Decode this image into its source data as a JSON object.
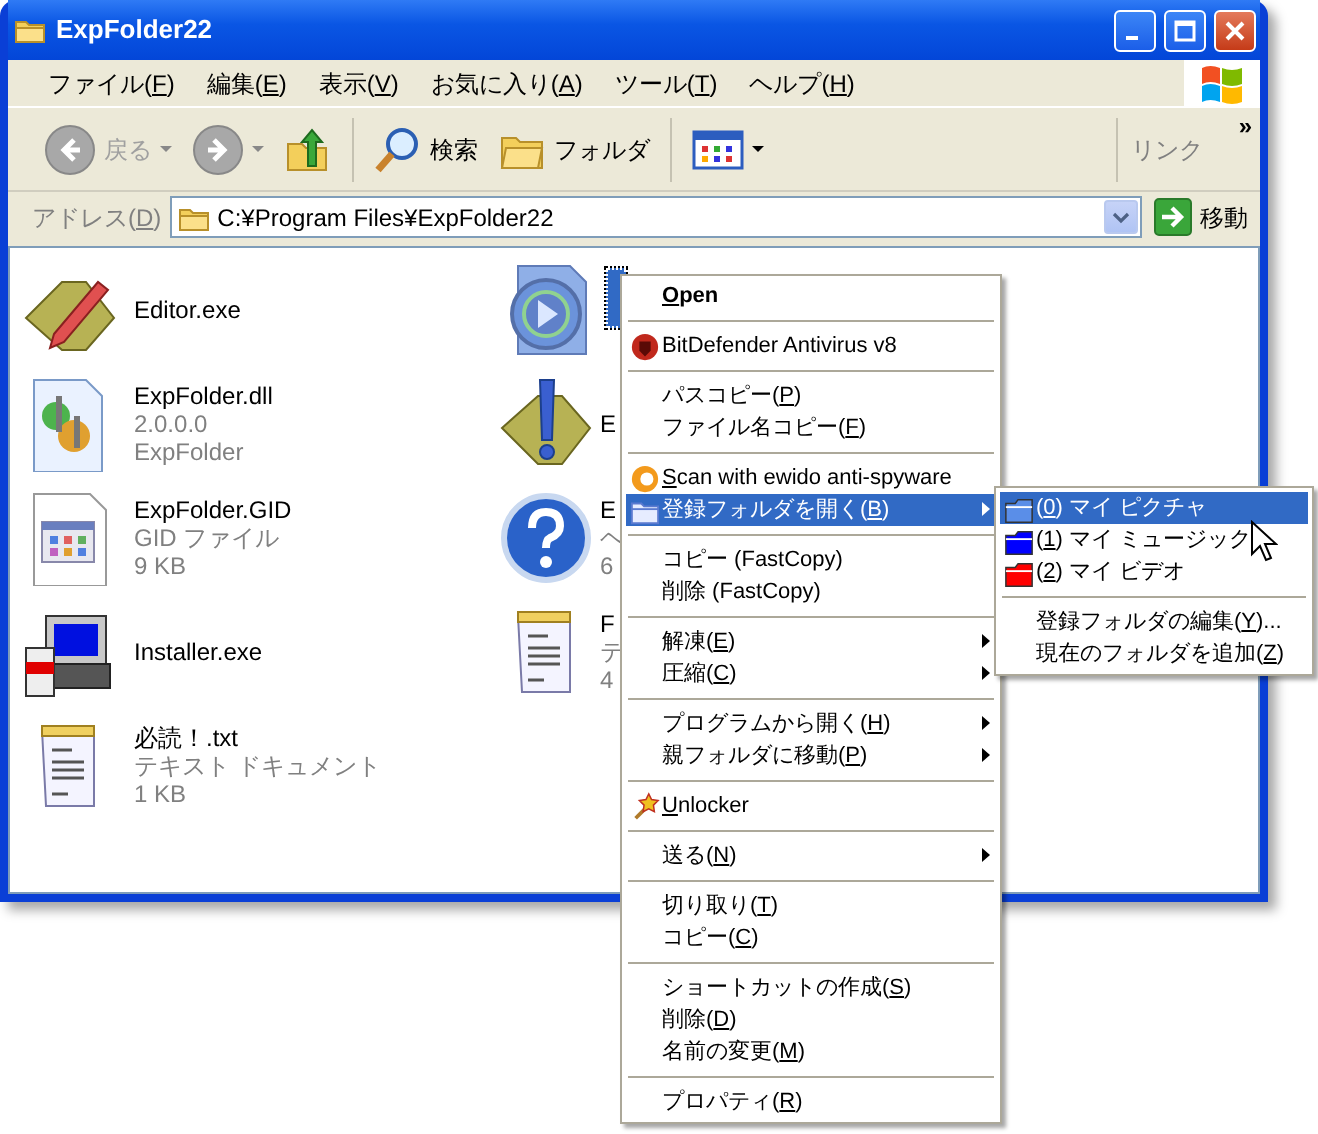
{
  "window": {
    "title": "ExpFolder22"
  },
  "menu_bar": [
    {
      "before": "ファイル(",
      "key": "F",
      "after": ")"
    },
    {
      "before": "編集(",
      "key": "E",
      "after": ")"
    },
    {
      "before": "表示(",
      "key": "V",
      "after": ")"
    },
    {
      "before": "お気に入り(",
      "key": "A",
      "after": ")"
    },
    {
      "before": "ツール(",
      "key": "T",
      "after": ")"
    },
    {
      "before": "ヘルプ(",
      "key": "H",
      "after": ")"
    }
  ],
  "toolbar": {
    "back": {
      "label": "戻る",
      "disabled": true
    },
    "forward": {
      "disabled": true
    },
    "search": "検索",
    "folders": "フォルダ",
    "links": "リンク",
    "more": "»"
  },
  "address_bar": {
    "label": {
      "before": "アドレス(",
      "key": "D",
      "after": ")"
    },
    "value": "C:¥Program Files¥ExpFolder22",
    "go": "移動"
  },
  "files": [
    {
      "name": "Editor.exe",
      "selected": false
    },
    {
      "name": "ExpFolder.dll",
      "lines": [
        "2.0.0.0",
        "ExpFolder"
      ],
      "selected": false
    },
    {
      "name": "ExpFolder.GID",
      "lines": [
        "GID ファイル",
        "9 KB"
      ],
      "selected": false
    },
    {
      "name": "Installer.exe",
      "selected": false
    },
    {
      "name": "必読！.txt",
      "lines": [
        "テキスト ドキュメント",
        "1 KB"
      ],
      "selected": false
    },
    {
      "selected": true
    },
    {
      "name": "E",
      "selected": false
    },
    {
      "name": "E",
      "lines": [
        "ヘ",
        "6"
      ],
      "selected": false
    },
    {
      "name": "F",
      "lines": [
        "テ",
        "4"
      ],
      "selected": false
    }
  ],
  "context_menu": {
    "items": [
      {
        "kind": "item",
        "key": "O",
        "after": "pen",
        "default": true,
        "submenu": false,
        "selected": false
      },
      {
        "kind": "separator"
      },
      {
        "kind": "item",
        "before": "BitDefender Antivirus v8",
        "submenu": false,
        "selected": false
      },
      {
        "kind": "separator"
      },
      {
        "kind": "item",
        "before": "パスコピー(",
        "key": "P",
        "after": ")",
        "submenu": false,
        "selected": false
      },
      {
        "kind": "item",
        "before": "ファイル名コピー(",
        "key": "F",
        "after": ")",
        "submenu": false,
        "selected": false
      },
      {
        "kind": "separator"
      },
      {
        "kind": "item",
        "key": "S",
        "after": "can with ewido anti-spyware",
        "submenu": false,
        "selected": false
      },
      {
        "kind": "item",
        "before": "登録フォルダを開く(",
        "key": "B",
        "after": ")",
        "submenu": true,
        "selected": true
      },
      {
        "kind": "separator"
      },
      {
        "kind": "item",
        "before": "コピー (FastCopy)",
        "submenu": false,
        "selected": false
      },
      {
        "kind": "item",
        "before": "削除 (FastCopy)",
        "submenu": false,
        "selected": false
      },
      {
        "kind": "separator"
      },
      {
        "kind": "item",
        "before": "解凍(",
        "key": "E",
        "after": ")",
        "submenu": true,
        "selected": false
      },
      {
        "kind": "item",
        "before": "圧縮(",
        "key": "C",
        "after": ")",
        "submenu": true,
        "selected": false
      },
      {
        "kind": "separator"
      },
      {
        "kind": "item",
        "before": "プログラムから開く(",
        "key": "H",
        "after": ")",
        "submenu": true,
        "selected": false
      },
      {
        "kind": "item",
        "before": "親フォルダに移動(",
        "key": "P",
        "after": ")",
        "submenu": true,
        "selected": false
      },
      {
        "kind": "separator"
      },
      {
        "kind": "item",
        "key": "U",
        "after": "nlocker",
        "submenu": false,
        "selected": false
      },
      {
        "kind": "separator"
      },
      {
        "kind": "item",
        "before": "送る(",
        "key": "N",
        "after": ")",
        "submenu": true,
        "selected": false
      },
      {
        "kind": "separator"
      },
      {
        "kind": "item",
        "before": "切り取り(",
        "key": "T",
        "after": ")",
        "submenu": false,
        "selected": false
      },
      {
        "kind": "item",
        "before": "コピー(",
        "key": "C",
        "after": ")",
        "submenu": false,
        "selected": false
      },
      {
        "kind": "separator"
      },
      {
        "kind": "item",
        "before": "ショートカットの作成(",
        "key": "S",
        "after": ")",
        "submenu": false,
        "selected": false
      },
      {
        "kind": "item",
        "before": "削除(",
        "key": "D",
        "after": ")",
        "submenu": false,
        "selected": false
      },
      {
        "kind": "item",
        "before": "名前の変更(",
        "key": "M",
        "after": ")",
        "submenu": false,
        "selected": false
      },
      {
        "kind": "separator"
      },
      {
        "kind": "item",
        "before": "プロパティ(",
        "key": "R",
        "after": ")",
        "submenu": false,
        "selected": false
      }
    ]
  },
  "submenu": {
    "items": [
      {
        "kind": "folder",
        "before": "(",
        "key": "0",
        "after": ") マイ ピクチャ",
        "color": "#5a8ee8",
        "selected": true
      },
      {
        "kind": "folder",
        "before": "(",
        "key": "1",
        "after": ") マイ ミュージック",
        "color": "#0000ff",
        "selected": false
      },
      {
        "kind": "folder",
        "before": "(",
        "key": "2",
        "after": ") マイ ビデオ",
        "color": "#ff0000",
        "selected": false
      },
      {
        "kind": "separator"
      },
      {
        "kind": "item",
        "before": "登録フォルダの編集(",
        "key": "Y",
        "after": ")...",
        "selected": false
      },
      {
        "kind": "item",
        "before": "現在のフォルダを追加(",
        "key": "Z",
        "after": ")",
        "selected": false
      }
    ]
  }
}
